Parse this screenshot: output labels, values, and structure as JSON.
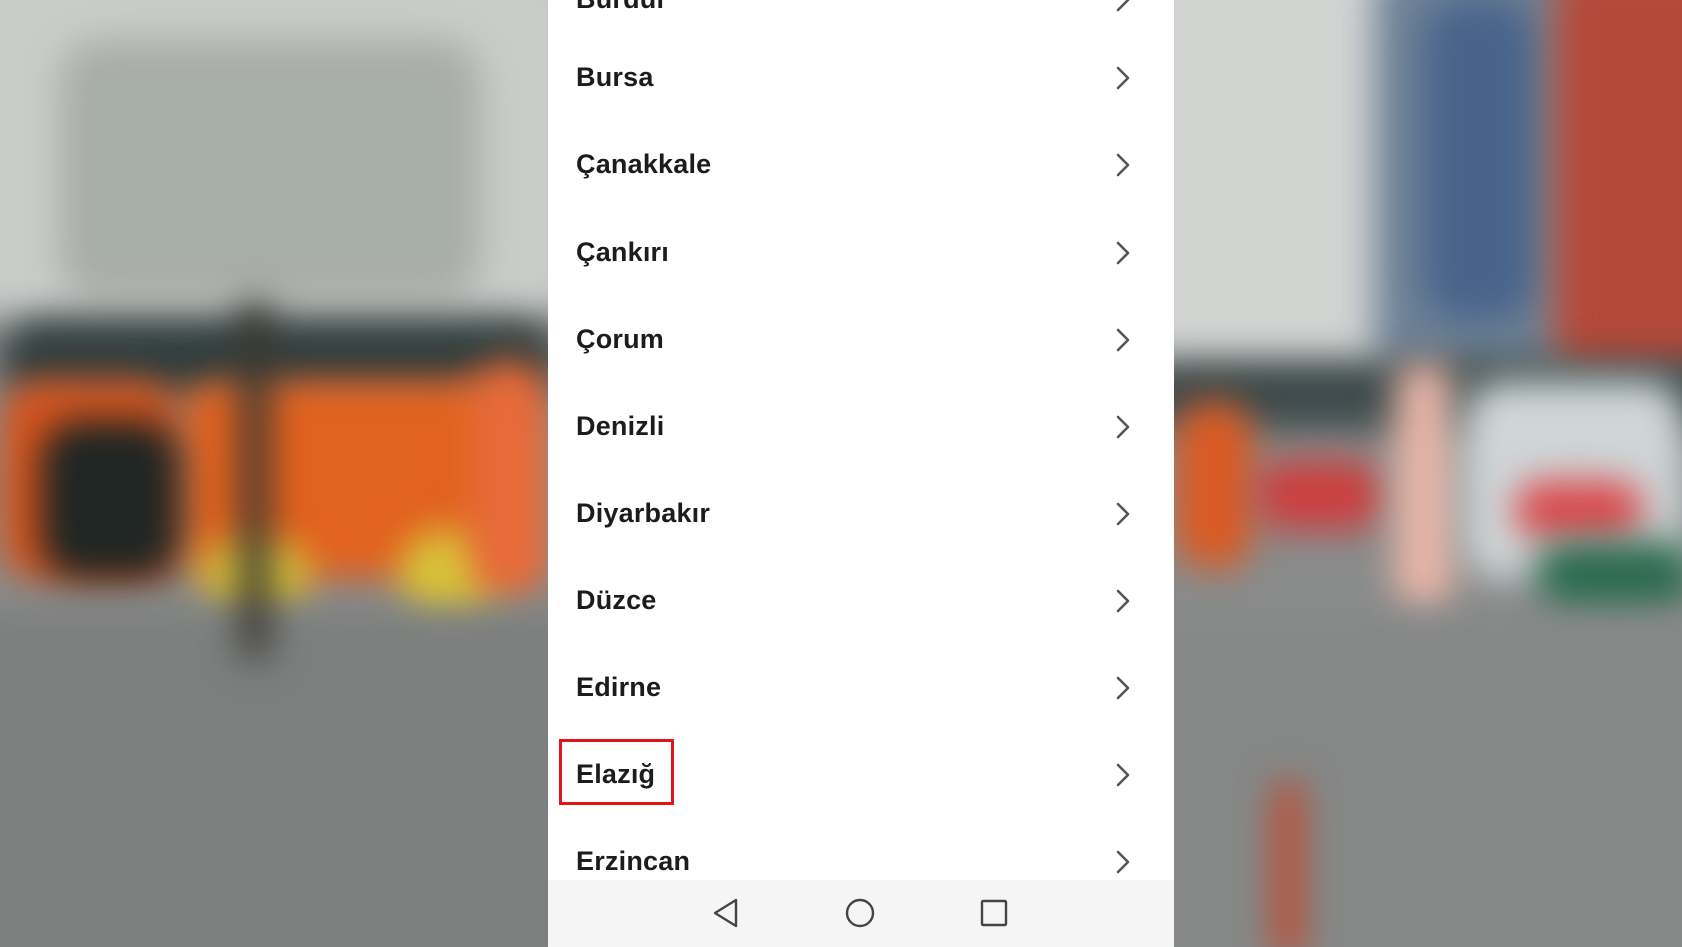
{
  "list": {
    "items": [
      {
        "label": "Burdur"
      },
      {
        "label": "Bursa"
      },
      {
        "label": "Çanakkale"
      },
      {
        "label": "Çankırı"
      },
      {
        "label": "Çorum"
      },
      {
        "label": "Denizli"
      },
      {
        "label": "Diyarbakır"
      },
      {
        "label": "Düzce"
      },
      {
        "label": "Edirne"
      },
      {
        "label": "Elazığ"
      },
      {
        "label": "Erzincan"
      }
    ],
    "highlighted_item": "Elazığ"
  },
  "navbar": {
    "icons": [
      "back-icon",
      "home-icon",
      "recents-icon"
    ]
  },
  "colors": {
    "highlight": "#e0141b",
    "text": "#1c1c1c",
    "chevron": "#555555",
    "background": "#ffffff"
  }
}
